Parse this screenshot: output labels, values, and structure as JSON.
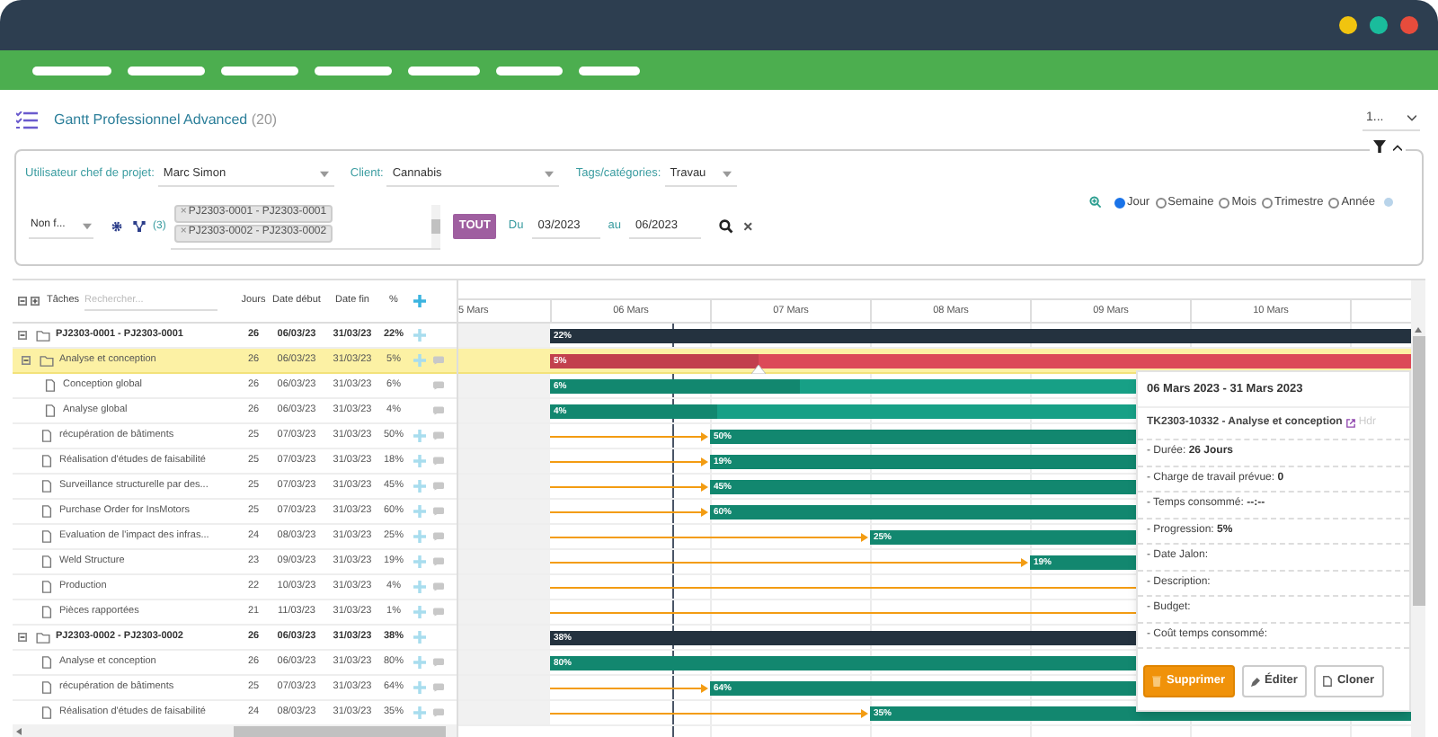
{
  "app": {
    "title": "Gantt Professionnel Advanced",
    "count": "(20)",
    "page_select": "1..."
  },
  "filters": {
    "fields": [
      {
        "label": "Utilisateur chef de projet:",
        "value": "Marc Simon"
      },
      {
        "label": "Client:",
        "value": "Cannabis"
      },
      {
        "label": "Tags/catégories:",
        "value": "Travau"
      }
    ],
    "status_select": "Non f...",
    "project_count": "(3)",
    "projects": [
      {
        "remove": "×",
        "label": "PJ2303-0001 - PJ2303-0001"
      },
      {
        "remove": "×",
        "label": "PJ2303-0002 - PJ2303-0002"
      }
    ],
    "all_button": "TOUT",
    "from_label": "Du",
    "from": "03/2023",
    "to_label": "au",
    "to": "06/2023",
    "clear": "×",
    "scales": [
      {
        "label": "Jour",
        "selected": true
      },
      {
        "label": "Semaine",
        "selected": false
      },
      {
        "label": "Mois",
        "selected": false
      },
      {
        "label": "Trimestre",
        "selected": false
      },
      {
        "label": "Année",
        "selected": false
      }
    ]
  },
  "grid": {
    "columns": {
      "tasks": "Tâches",
      "search_placeholder": "Rechercher...",
      "days": "Jours",
      "start": "Date début",
      "end": "Date fin",
      "percent": "%"
    },
    "rows": [
      {
        "kind": "project",
        "name": "PJ2303-0001 - PJ2303-0001",
        "days": "26",
        "start": "06/03/23",
        "end": "31/03/23",
        "percent": "22%",
        "bar_label": "22%",
        "selected": false,
        "expanded": true,
        "addable": true,
        "comment": false,
        "children": [
          {
            "kind": "folder",
            "name": "Analyse et conception",
            "days": "26",
            "start": "06/03/23",
            "end": "31/03/23",
            "percent": "5%",
            "bar_label": "5%",
            "selected": true,
            "expanded": true,
            "addable": true,
            "comment": true,
            "children": [
              {
                "kind": "task",
                "name": "Conception global",
                "days": "26",
                "start": "06/03/23",
                "end": "31/03/23",
                "percent": "6%",
                "bar_label": "6%",
                "selected": false,
                "addable": false,
                "comment": true
              },
              {
                "kind": "task",
                "name": "Analyse global",
                "days": "26",
                "start": "06/03/23",
                "end": "31/03/23",
                "percent": "4%",
                "bar_label": "4%",
                "selected": false,
                "addable": false,
                "comment": true
              }
            ]
          },
          {
            "kind": "task",
            "name": "récupération de bâtiments",
            "days": "25",
            "start": "07/03/23",
            "end": "31/03/23",
            "percent": "50%",
            "bar_label": "50%",
            "selected": false,
            "addable": true,
            "comment": true
          },
          {
            "kind": "task",
            "name": "Réalisation d'études de faisabilité",
            "days": "25",
            "start": "07/03/23",
            "end": "31/03/23",
            "percent": "18%",
            "bar_label": "19%",
            "selected": false,
            "addable": true,
            "comment": true
          },
          {
            "kind": "task",
            "name": "Surveillance structurelle par des...",
            "days": "25",
            "start": "07/03/23",
            "end": "31/03/23",
            "percent": "45%",
            "bar_label": "45%",
            "selected": false,
            "addable": true,
            "comment": true
          },
          {
            "kind": "task",
            "name": "Purchase Order for InsMotors",
            "days": "25",
            "start": "07/03/23",
            "end": "31/03/23",
            "percent": "60%",
            "bar_label": "60%",
            "selected": false,
            "addable": true,
            "comment": true
          },
          {
            "kind": "task",
            "name": "Evaluation de l'impact des infras...",
            "days": "24",
            "start": "08/03/23",
            "end": "31/03/23",
            "percent": "25%",
            "bar_label": "25%",
            "selected": false,
            "addable": true,
            "comment": true
          },
          {
            "kind": "task",
            "name": "Weld Structure",
            "days": "23",
            "start": "09/03/23",
            "end": "31/03/23",
            "percent": "19%",
            "bar_label": "19%",
            "selected": false,
            "addable": true,
            "comment": true
          },
          {
            "kind": "task",
            "name": "Production",
            "days": "22",
            "start": "10/03/23",
            "end": "31/03/23",
            "percent": "4%",
            "selected": false,
            "addable": true,
            "comment": true
          },
          {
            "kind": "task",
            "name": "Pièces rapportées",
            "days": "21",
            "start": "11/03/23",
            "end": "31/03/23",
            "percent": "1%",
            "selected": false,
            "addable": true,
            "comment": true
          }
        ]
      },
      {
        "kind": "project",
        "name": "PJ2303-0002 - PJ2303-0002",
        "days": "26",
        "start": "06/03/23",
        "end": "31/03/23",
        "percent": "38%",
        "bar_label": "38%",
        "selected": false,
        "expanded": true,
        "addable": true,
        "comment": false,
        "children": [
          {
            "kind": "task",
            "name": "Analyse et conception",
            "days": "26",
            "start": "06/03/23",
            "end": "31/03/23",
            "percent": "80%",
            "bar_label": "80%",
            "selected": false,
            "addable": true,
            "comment": true
          },
          {
            "kind": "task",
            "name": "récupération de bâtiments",
            "days": "25",
            "start": "07/03/23",
            "end": "31/03/23",
            "percent": "64%",
            "bar_label": "64%",
            "selected": false,
            "addable": true,
            "comment": true
          },
          {
            "kind": "task",
            "name": "Réalisation d'études de faisabilité",
            "days": "24",
            "start": "08/03/23",
            "end": "31/03/23",
            "percent": "35%",
            "bar_label": "35%",
            "selected": false,
            "addable": true,
            "comment": true
          }
        ]
      }
    ]
  },
  "timeline": {
    "days": [
      "5 Mars",
      "06 Mars",
      "07 Mars",
      "08 Mars",
      "09 Mars",
      "10 Mars"
    ]
  },
  "tooltip": {
    "dates": "06 Mars 2023 - 31 Mars 2023",
    "ref": "TK2303-10332 - Analyse et conception",
    "extra": "Hdr",
    "fields": [
      {
        "label": "- Durée:",
        "value": "26 Jours"
      },
      {
        "label": "- Charge de travail prévue:",
        "value": "0"
      },
      {
        "label": "- Temps consommé:",
        "value": "--:--"
      },
      {
        "label": "- Progression:",
        "value": "5%"
      },
      {
        "label": "- Date Jalon:"
      },
      {
        "label": "- Description:"
      },
      {
        "label": "- Budget:"
      },
      {
        "label": "- Coût temps consommé:"
      }
    ],
    "buttons": [
      {
        "label": "Supprimer",
        "kind": "delete"
      },
      {
        "label": "Éditer",
        "kind": "edit"
      },
      {
        "label": "Cloner",
        "kind": "clone"
      }
    ]
  }
}
